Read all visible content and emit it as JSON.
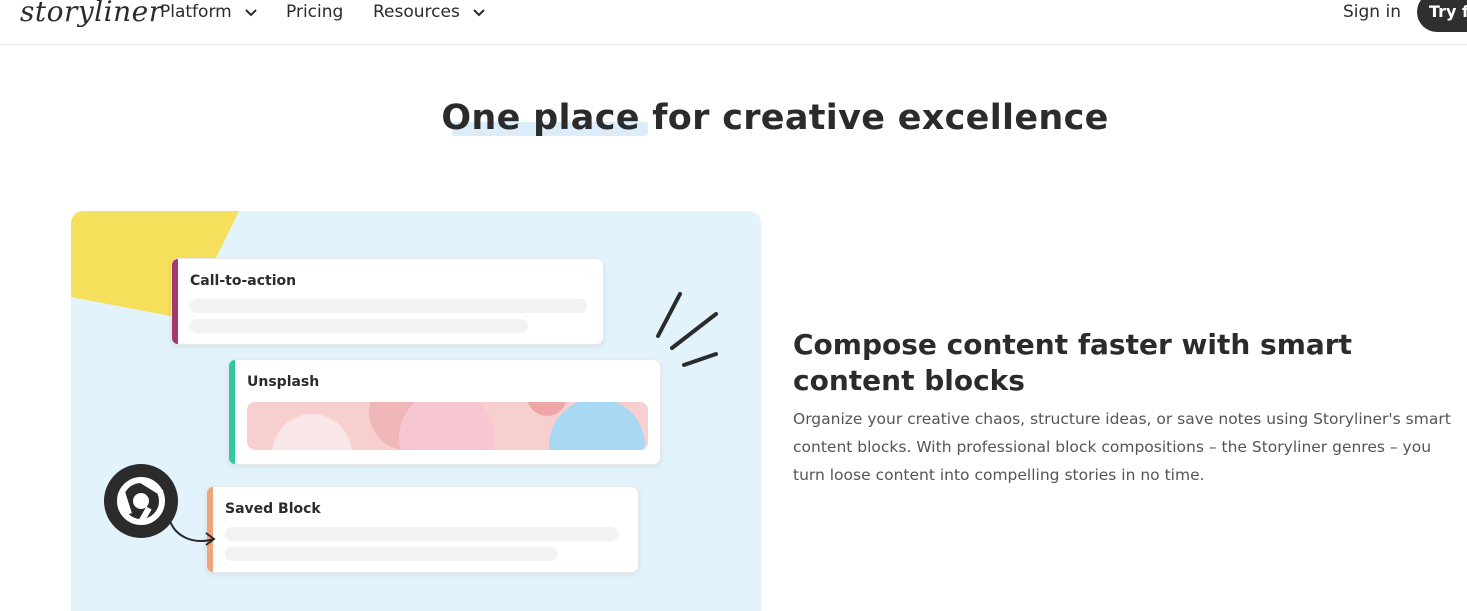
{
  "header": {
    "logo": "storyliner",
    "nav": [
      {
        "label": "Platform",
        "has_dropdown": true
      },
      {
        "label": "Pricing",
        "has_dropdown": false
      },
      {
        "label": "Resources",
        "has_dropdown": true
      }
    ],
    "signin_label": "Sign in",
    "cta_label": "Try fo"
  },
  "hero": {
    "title": "One place for creative excellence"
  },
  "illustration": {
    "cards": [
      {
        "title": "Call-to-action",
        "accent": "#a33a6b"
      },
      {
        "title": "Unsplash",
        "accent": "#2fc9a0"
      },
      {
        "title": "Saved Block",
        "accent": "#f0a47a"
      }
    ],
    "icons": [
      "chrome-icon",
      "arrow-icon"
    ]
  },
  "feature": {
    "title": "Compose content faster with smart content blocks",
    "body": "Organize your creative chaos, structure ideas, or save notes using Storyliner's smart content blocks. With professional block compositions – the Storyliner genres – you turn loose content into compelling stories in no time."
  },
  "colors": {
    "panel_bg": "#e3f3fc",
    "yellow": "#f6df5a",
    "dark": "#2b2b2b"
  }
}
